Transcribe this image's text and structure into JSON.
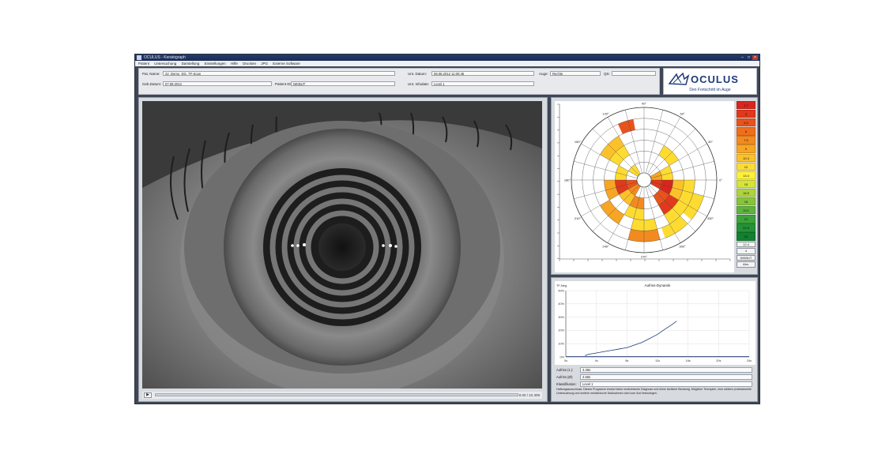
{
  "window": {
    "title": "OCULUS - Keratograph",
    "menu": [
      "Patient",
      "Untersuchung",
      "Darstellung",
      "Einstellungen",
      "Hilfe",
      "Drucken",
      "JPG",
      "Externe Software"
    ]
  },
  "patient": {
    "name_label": "Pat. Name:",
    "name_value": "22_Demo_DG, TF-Scan",
    "birth_label": "Geb.Datum:",
    "birth_value": "07.08.2012",
    "patid_label": "Patient ID:",
    "patid_value": "NIKBUT",
    "exam_date_label": "Unt. Datum:",
    "exam_date_value": "08.08.2012 11:00:46",
    "eye_label": "Auge:",
    "eye_value": "Rechts",
    "quality_label": "QS:",
    "quality_value": "",
    "exam_info_label": "Unt. Infodate:",
    "exam_info_value": "Level 1"
  },
  "logo": {
    "brand": "OCULUS",
    "tagline": "Den Fortschritt im Auge"
  },
  "video": {
    "play": "▶",
    "timecode": "0.00 / 22.309"
  },
  "breakup_scale": {
    "cells": [
      {
        "label": "1.7",
        "color": "#d7261e"
      },
      {
        "label": "3",
        "color": "#e0391c"
      },
      {
        "label": "4.5",
        "color": "#e8531b"
      },
      {
        "label": "6",
        "color": "#ee6e1c"
      },
      {
        "label": "7.5",
        "color": "#f38a20"
      },
      {
        "label": "9",
        "color": "#f7a525"
      },
      {
        "label": "10.4",
        "color": "#fbc12b"
      },
      {
        "label": "12",
        "color": "#fddb31"
      },
      {
        "label": "13.4",
        "color": "#fdf03a"
      },
      {
        "label": "15",
        "color": "#d6e43a"
      },
      {
        "label": "16.5",
        "color": "#aed43a"
      },
      {
        "label": "18",
        "color": "#86c43a"
      },
      {
        "label": "19.1",
        "color": "#5fb33a"
      },
      {
        "label": "21",
        "color": "#3ca33a"
      },
      {
        "label": "22.5",
        "color": "#249236"
      },
      {
        "label": "23",
        "color": "#128030"
      }
    ],
    "buttons": [
      "12.4",
      "4",
      "NIKBUT",
      "Abs."
    ]
  },
  "polar": {
    "angle_labels": [
      "0°",
      "30°",
      "60°",
      "90°",
      "120°",
      "150°",
      "180°",
      "210°",
      "240°",
      "270°",
      "300°",
      "330°"
    ],
    "segments": [
      {
        "ring": 1,
        "a0": 180,
        "a1": 210,
        "color": "#e8531b"
      },
      {
        "ring": 1,
        "a0": 210,
        "a1": 240,
        "color": "#f38a20"
      },
      {
        "ring": 1,
        "a0": 330,
        "a1": 360,
        "color": "#e0391c"
      },
      {
        "ring": 1,
        "a0": 0,
        "a1": 30,
        "color": "#f7a525"
      },
      {
        "ring": 1,
        "a0": 120,
        "a1": 150,
        "color": "#fddb31"
      },
      {
        "ring": 2,
        "a0": 180,
        "a1": 210,
        "color": "#e0391c"
      },
      {
        "ring": 2,
        "a0": 210,
        "a1": 240,
        "color": "#fbc12b"
      },
      {
        "ring": 2,
        "a0": 150,
        "a1": 180,
        "color": "#fddb31"
      },
      {
        "ring": 2,
        "a0": 330,
        "a1": 360,
        "color": "#d7261e"
      },
      {
        "ring": 2,
        "a0": 0,
        "a1": 30,
        "color": "#fddb31"
      },
      {
        "ring": 2,
        "a0": 300,
        "a1": 330,
        "color": "#e8531b"
      },
      {
        "ring": 2,
        "a0": 240,
        "a1": 270,
        "color": "#f38a20"
      },
      {
        "ring": 3,
        "a0": 120,
        "a1": 150,
        "color": "#fddb31"
      },
      {
        "ring": 3,
        "a0": 180,
        "a1": 210,
        "color": "#f7a525"
      },
      {
        "ring": 3,
        "a0": 300,
        "a1": 330,
        "color": "#e0391c"
      },
      {
        "ring": 3,
        "a0": 330,
        "a1": 360,
        "color": "#fbc12b"
      },
      {
        "ring": 3,
        "a0": 30,
        "a1": 60,
        "color": "#fddb31"
      },
      {
        "ring": 3,
        "a0": 240,
        "a1": 270,
        "color": "#fddb31"
      },
      {
        "ring": 4,
        "a0": 120,
        "a1": 150,
        "color": "#fbc12b"
      },
      {
        "ring": 4,
        "a0": 300,
        "a1": 330,
        "color": "#fddb31"
      },
      {
        "ring": 4,
        "a0": 330,
        "a1": 360,
        "color": "#fddb31"
      },
      {
        "ring": 4,
        "a0": 210,
        "a1": 240,
        "color": "#f7a525"
      },
      {
        "ring": 5,
        "a0": 100,
        "a1": 115,
        "color": "#e8531b"
      },
      {
        "ring": 5,
        "a0": 320,
        "a1": 345,
        "color": "#fddb31"
      },
      {
        "ring": 5,
        "a0": 255,
        "a1": 285,
        "color": "#f38a20"
      },
      {
        "ring": 4,
        "a0": 255,
        "a1": 285,
        "color": "#fddb31"
      },
      {
        "ring": 5,
        "a0": 290,
        "a1": 315,
        "color": "#fddb31"
      }
    ]
  },
  "graph": {
    "title": "Aufriss-Dynamik",
    "y_ticks": [
      "0%",
      "10%",
      "20%",
      "30%",
      "40%",
      "50%"
    ],
    "x_ticks": [
      "0s",
      "4s",
      "8s",
      "12s",
      "16s",
      "20s",
      "24s"
    ],
    "corner_label": "TF-Neg.",
    "curve": [
      [
        2.5,
        1
      ],
      [
        3,
        2
      ],
      [
        4,
        3
      ],
      [
        5,
        4
      ],
      [
        6,
        5
      ],
      [
        7,
        6
      ],
      [
        8,
        7
      ],
      [
        9,
        9
      ],
      [
        10,
        11
      ],
      [
        11,
        14
      ],
      [
        12,
        17
      ],
      [
        13,
        21
      ],
      [
        13.8,
        24
      ],
      [
        14.5,
        27
      ]
    ],
    "fields": [
      {
        "label": "Aufriss (1.):",
        "value": "3.36s"
      },
      {
        "label": "Aufriss (Ø):",
        "value": "4.66s"
      },
      {
        "label": "Klassifikation:",
        "value": "Level 1"
      }
    ],
    "note": "Haftungsausschluss: Dieses Programm ersetzt keine medizinische Diagnose und keine ärztliche Beratung. Mögliche Therapien, eine weitere professionelle Untersuchung und weitere medizinische Maßnahmen sind vom Arzt festzulegen."
  }
}
